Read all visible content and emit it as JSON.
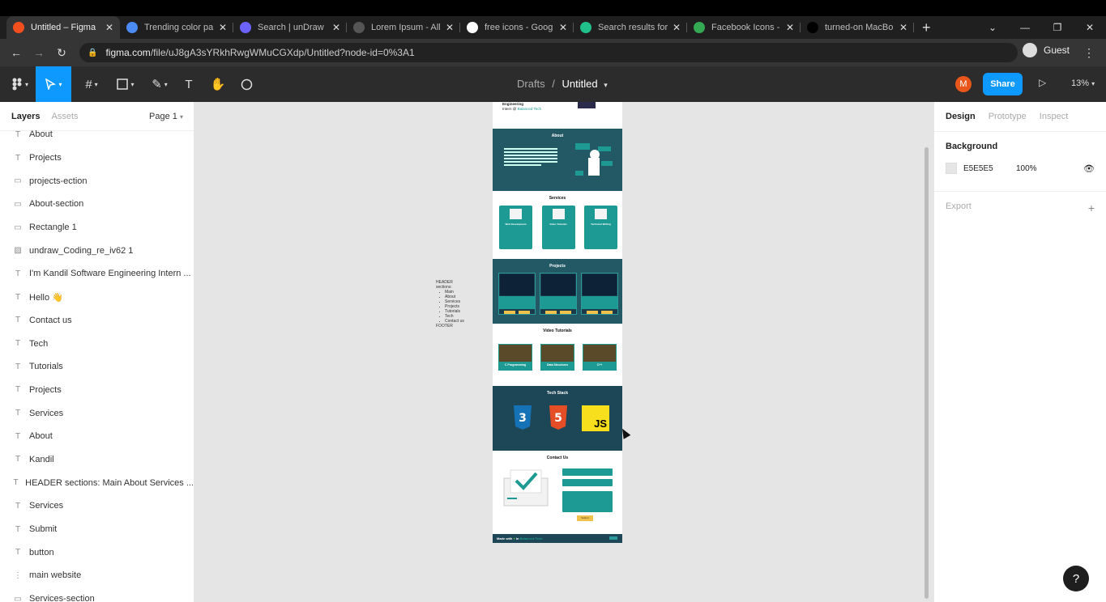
{
  "browser": {
    "tabs": [
      {
        "title": "Untitled – Figma",
        "active": true,
        "icon": "figma-icon",
        "color": "#f24e1e"
      },
      {
        "title": "Trending color pa",
        "active": false,
        "icon": "coolors-icon",
        "color": "#4b8af0"
      },
      {
        "title": "Search | unDraw",
        "active": false,
        "icon": "undraw-icon",
        "color": "#6c63ff"
      },
      {
        "title": "Lorem Ipsum - All",
        "active": false,
        "icon": "loading-icon",
        "color": "#555555"
      },
      {
        "title": "free icons - Goog",
        "active": false,
        "icon": "google-icon",
        "color": "#ffffff"
      },
      {
        "title": "Search results for",
        "active": false,
        "icon": "vector-icon",
        "color": "#21c08b"
      },
      {
        "title": "Facebook Icons -",
        "active": false,
        "icon": "sheets-icon",
        "color": "#34a853"
      },
      {
        "title": "turned-on MacBo",
        "active": false,
        "icon": "unsplash-icon",
        "color": "#000000"
      }
    ],
    "url_host": "figma.com",
    "url_path": "/file/uJ8gA3sYRkhRwgWMuCGXdp/Untitled?node-id=0%3A1",
    "profile": "Guest"
  },
  "figma": {
    "crumb_parent": "Drafts",
    "crumb_sep": "/",
    "file_name": "Untitled",
    "user_initial": "M",
    "share_label": "Share",
    "zoom": "13%",
    "left_tabs": {
      "layers": "Layers",
      "assets": "Assets",
      "page": "Page 1"
    },
    "layers": [
      {
        "type": "text",
        "name": "About"
      },
      {
        "type": "text",
        "name": "Projects"
      },
      {
        "type": "rect",
        "name": "projects-ection"
      },
      {
        "type": "rect",
        "name": "About-section"
      },
      {
        "type": "rect",
        "name": "Rectangle 1"
      },
      {
        "type": "image",
        "name": "undraw_Coding_re_iv62 1"
      },
      {
        "type": "text",
        "name": "I'm Kandil Software Engineering Intern ..."
      },
      {
        "type": "text",
        "name": "Hello 👋"
      },
      {
        "type": "text",
        "name": "Contact us"
      },
      {
        "type": "text",
        "name": "Tech"
      },
      {
        "type": "text",
        "name": "Tutorials"
      },
      {
        "type": "text",
        "name": "Projects"
      },
      {
        "type": "text",
        "name": "Services"
      },
      {
        "type": "text",
        "name": "About"
      },
      {
        "type": "text",
        "name": "Kandil"
      },
      {
        "type": "text",
        "name": "HEADER sections: Main About Services ..."
      },
      {
        "type": "text",
        "name": "Services"
      },
      {
        "type": "text",
        "name": "Submit"
      },
      {
        "type": "text",
        "name": "button"
      },
      {
        "type": "line",
        "name": "main website"
      },
      {
        "type": "rect",
        "name": "Services-section"
      }
    ],
    "right_tabs": {
      "design": "Design",
      "prototype": "Prototype",
      "inspect": "Inspect"
    },
    "background_label": "Background",
    "background_hex": "E5E5E5",
    "background_opacity": "100%",
    "export_label": "Export",
    "canvas_note": {
      "title": "HEADER",
      "subtitle": "sections:",
      "items": [
        "Main",
        "About",
        "Services",
        "Projects",
        "Tutorials",
        "Tech",
        "Contact us"
      ],
      "footer": "FOOTER"
    },
    "site": {
      "intro_line1": "Engineering",
      "intro_line2_a": "Intern @ ",
      "intro_line2_b": "Balanced Tech",
      "about_title": "About",
      "services_title": "Services",
      "services": [
        "Web Development",
        "Video Tutorials",
        "Technical Writing"
      ],
      "projects_title": "Projects",
      "video_title": "Video Tutorials",
      "videos": [
        "C Programming",
        "Data Structures",
        "C++"
      ],
      "tech_title": "Tech Stack",
      "tech": [
        "CSS3",
        "HTML5",
        "JS"
      ],
      "contact_title": "Contact Us",
      "submit": "Submit",
      "footer_a": "Made with ",
      "footer_b": " in ",
      "footer_c": "Balanced Tech"
    }
  }
}
